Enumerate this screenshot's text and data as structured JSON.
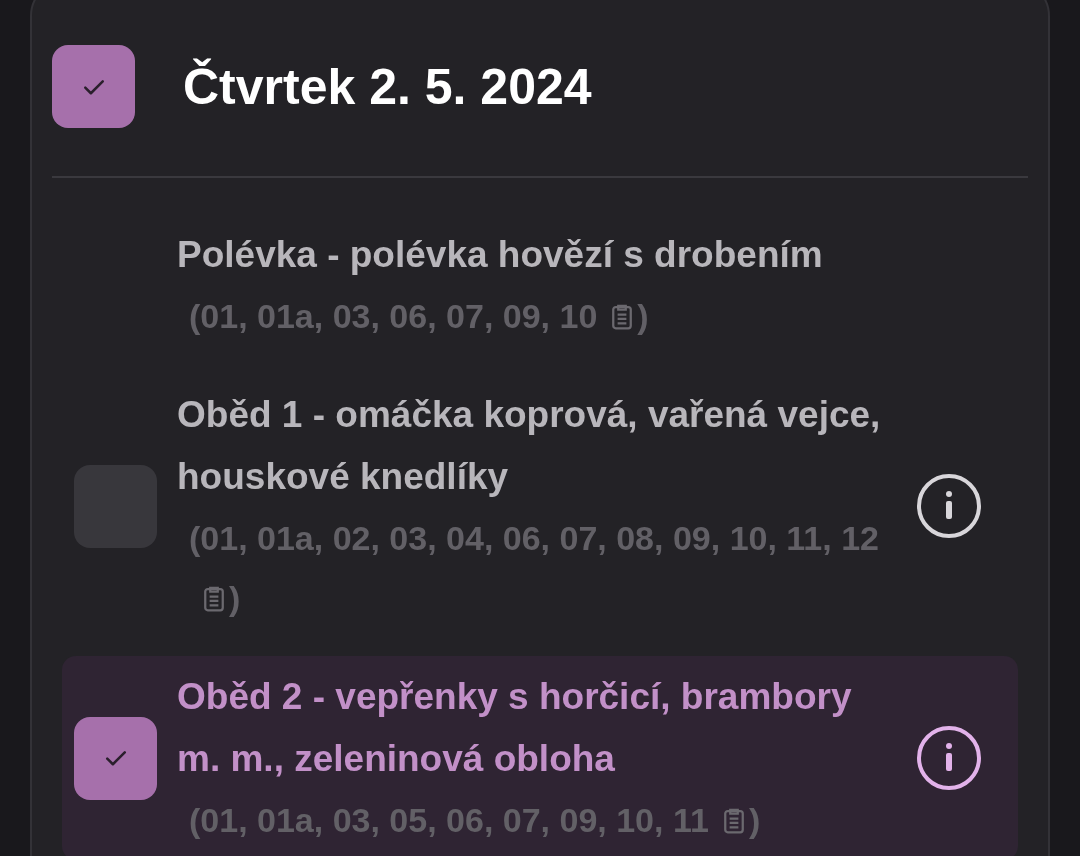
{
  "day": {
    "title": "Čtvrtek 2. 5. 2024",
    "checked": true
  },
  "items": [
    {
      "kind": "soup",
      "name": "Polévka - polévka hovězí s drobením",
      "allergens": "(01, 01a, 03, 06, 07, 09, 10",
      "allergens_end": ")"
    },
    {
      "kind": "meal",
      "name": "Oběd 1 - omáčka koprová, vařená vejce, houskové knedlíky",
      "allergens": "(01, 01a, 02, 03, 04, 06, 07, 08, 09, 10, 11, 12",
      "allergens_end": ")",
      "checked": false
    },
    {
      "kind": "meal",
      "name": "Oběd 2 - vepřenky s horčicí, brambory m. m., zeleninová obloha",
      "allergens": "(01, 01a, 03, 05, 06, 07, 09, 10, 11",
      "allergens_end": ")",
      "checked": true
    }
  ]
}
